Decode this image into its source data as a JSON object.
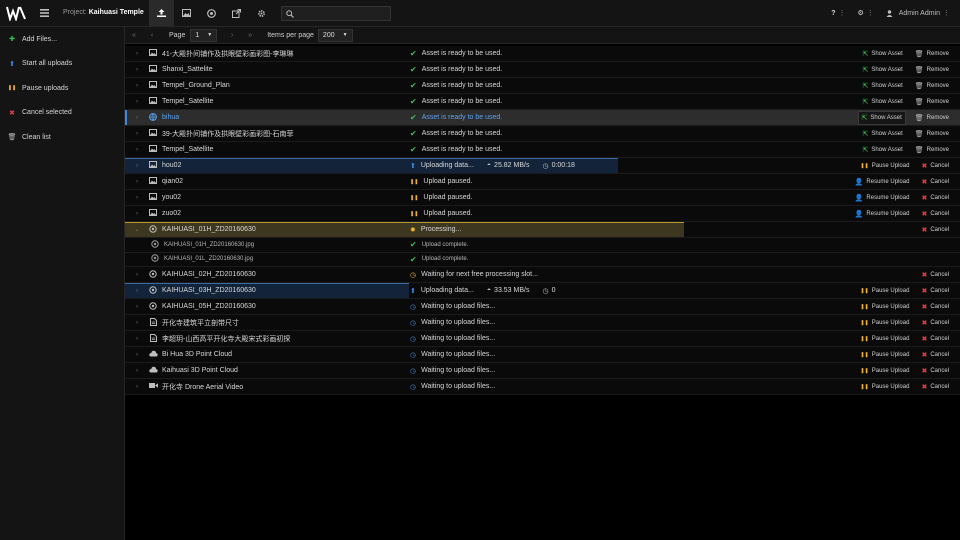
{
  "header": {
    "project_label": "Project:",
    "project_name": "Kaihuasi Temple",
    "search_placeholder": "",
    "help_label": "?",
    "user_name": "Admin Admin"
  },
  "sidebar": {
    "items": [
      {
        "label": "Add Files...",
        "icon": "plus-icon",
        "color": "#3cc24a"
      },
      {
        "label": "Start all uploads",
        "icon": "upload-icon",
        "color": "#3d8be0"
      },
      {
        "label": "Pause uploads",
        "icon": "pause-icon",
        "color": "#f0b42a"
      },
      {
        "label": "Cancel selected",
        "icon": "cancel-icon",
        "color": "#e04040"
      },
      {
        "label": "Clean list",
        "icon": "trash-icon",
        "color": "#bdbdbd"
      }
    ]
  },
  "pager": {
    "page_label": "Page",
    "page_value": "1",
    "items_label": "Items per page",
    "items_value": "200"
  },
  "rows": [
    {
      "name": "41-大殿扑间铺作及拱眼壁彩画彩图-李琳琳",
      "icon": "image-icon",
      "status": "Asset is ready to be used.",
      "state": "ready"
    },
    {
      "name": "Shanxi_Sattelite",
      "icon": "image-icon",
      "status": "Asset is ready to be used.",
      "state": "ready"
    },
    {
      "name": "Tempel_Ground_Plan",
      "icon": "image-icon",
      "status": "Asset is ready to be used.",
      "state": "ready"
    },
    {
      "name": "Tempel_Satellite",
      "icon": "image-icon",
      "status": "Asset is ready to be used.",
      "state": "ready"
    },
    {
      "name": "bihua",
      "icon": "globe-icon",
      "status": "Asset is ready to be used.",
      "state": "ready",
      "selected": true
    },
    {
      "name": "39-大殿扑间铺作及拱眼壁彩画彩图-石南菲",
      "icon": "image-icon",
      "status": "Asset is ready to be used.",
      "state": "ready"
    },
    {
      "name": "Tempel_Satellite",
      "icon": "image-icon",
      "status": "Asset is ready to be used.",
      "state": "ready"
    },
    {
      "name": "hou02",
      "icon": "image-icon",
      "status": "Uploading data...",
      "state": "uploading",
      "speed": "25.82 MB/s",
      "time": "0:00:18",
      "progress": 0.59
    },
    {
      "name": "qian02",
      "icon": "image-icon",
      "status": "Upload paused.",
      "state": "paused"
    },
    {
      "name": "you02",
      "icon": "image-icon",
      "status": "Upload paused.",
      "state": "paused"
    },
    {
      "name": "zuo02",
      "icon": "image-icon",
      "status": "Upload paused.",
      "state": "paused"
    },
    {
      "name": "KAIHUASI_01H_ZD20160630",
      "icon": "target-icon",
      "status": "Processing...",
      "state": "processing",
      "expanded": true,
      "progress": 0.67
    },
    {
      "name": "KAIHUASI_01H_ZD20160630.jpg",
      "icon": "target-icon",
      "status": "Upload complete.",
      "state": "subcomplete",
      "sub": true
    },
    {
      "name": "KAIHUASI_01L_ZD20160630.jpg",
      "icon": "target-icon",
      "status": "Upload complete.",
      "state": "subcomplete",
      "sub": true
    },
    {
      "name": "KAIHUASI_02H_ZD20160630",
      "icon": "target-icon",
      "status": "Waiting for next free processing slot...",
      "state": "slot"
    },
    {
      "name": "KAIHUASI_03H_ZD20160630",
      "icon": "target-icon",
      "status": "Uploading data...",
      "state": "uploading",
      "speed": "33.53 MB/s",
      "time": "0",
      "progress": 0.34
    },
    {
      "name": "KAIHUASI_05H_ZD20160630",
      "icon": "target-icon",
      "status": "Waiting to upload files...",
      "state": "waiting"
    },
    {
      "name": "开化寺建筑平立剖带尺寸",
      "icon": "document-icon",
      "status": "Waiting to upload files...",
      "state": "waiting"
    },
    {
      "name": "李超玥-山西高平开化寺大殿宋式彩画初探",
      "icon": "document-icon",
      "status": "Waiting to upload files...",
      "state": "waiting"
    },
    {
      "name": "Bi Hua 3D Point Cloud",
      "icon": "cloud-icon",
      "status": "Waiting to upload files...",
      "state": "waiting"
    },
    {
      "name": "Kaihuasi 3D Point Cloud",
      "icon": "cloud-icon",
      "status": "Waiting to upload files...",
      "state": "waiting"
    },
    {
      "name": "开化寺 Drone Aerial Video",
      "icon": "video-icon",
      "status": "Waiting to upload files...",
      "state": "waiting"
    }
  ],
  "actions": {
    "show_asset": "Show Asset",
    "remove": "Remove",
    "pause_upload": "Pause Upload",
    "resume_upload": "Resume Upload",
    "cancel": "Cancel"
  }
}
